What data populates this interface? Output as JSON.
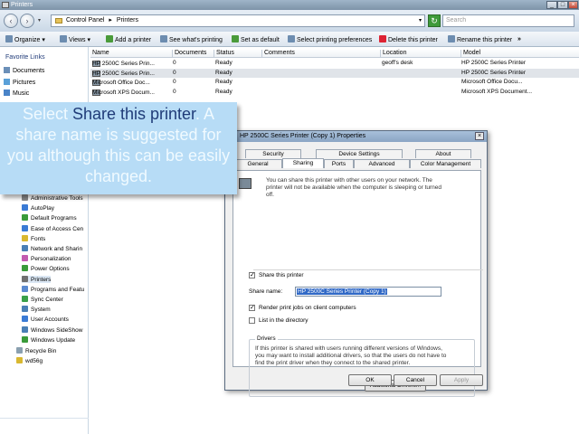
{
  "window": {
    "title": "Printers"
  },
  "address": {
    "parts": [
      "Control Panel",
      "Printers"
    ],
    "search_placeholder": "Search"
  },
  "toolbar": {
    "organize": "Organize",
    "views": "Views",
    "add_printer": "Add a printer",
    "see_printing": "See what's printing",
    "set_default": "Set as default",
    "select_prefs": "Select printing preferences",
    "delete_printer": "Delete this printer",
    "rename_printer": "Rename this printer",
    "more": "»"
  },
  "sidebar": {
    "heading": "Favorite Links",
    "favorites": [
      "Documents",
      "Pictures",
      "Music"
    ],
    "tree": [
      {
        "label": "Administrative Tools",
        "color": "#8a8a8a"
      },
      {
        "label": "AutoPlay",
        "color": "#3a7bd5"
      },
      {
        "label": "Default Programs",
        "color": "#3a9b3a"
      },
      {
        "label": "Ease of Access Cen",
        "color": "#3a7bd5"
      },
      {
        "label": "Fonts",
        "color": "#d9b830"
      },
      {
        "label": "Network and Sharin",
        "color": "#4a7fb5"
      },
      {
        "label": "Personalization",
        "color": "#c25bb0"
      },
      {
        "label": "Power Options",
        "color": "#3a9b3a"
      },
      {
        "label": "Printers",
        "color": "#707070"
      },
      {
        "label": "Programs and Featu",
        "color": "#5a8ad0"
      },
      {
        "label": "Sync Center",
        "color": "#3aa04a"
      },
      {
        "label": "System",
        "color": "#4a7fb5"
      },
      {
        "label": "User Accounts",
        "color": "#3a7bd5"
      },
      {
        "label": "Windows SideShow",
        "color": "#4a7fb5"
      },
      {
        "label": "Windows Update",
        "color": "#3a9b3a"
      },
      {
        "label": "Recycle Bin",
        "color": "#8aa0b0"
      },
      {
        "label": "wd56g",
        "color": "#d9b830"
      }
    ]
  },
  "columns": [
    "Name",
    "Documents",
    "Status",
    "Comments",
    "Location",
    "Model"
  ],
  "rows": [
    {
      "name": "HP 2500C Series Prin...",
      "docs": "0",
      "status": "Ready",
      "comments": "",
      "location": "geoff's desk",
      "model": "HP 2500C Series Printer"
    },
    {
      "name": "HP 2500C Series Prin...",
      "docs": "0",
      "status": "Ready",
      "comments": "",
      "location": "",
      "model": "HP 2500C Series Printer"
    },
    {
      "name": "Microsoft Office Doc...",
      "docs": "0",
      "status": "Ready",
      "comments": "",
      "location": "",
      "model": "Microsoft Office Docu..."
    },
    {
      "name": "Microsoft XPS Docum...",
      "docs": "0",
      "status": "Ready",
      "comments": "",
      "location": "",
      "model": "Microsoft XPS Document..."
    }
  ],
  "callout": {
    "pre": "Select ",
    "highlight": "Share this printer",
    "post": ". A share name is suggested for you although this can be easily changed."
  },
  "dialog": {
    "title": "HP 2500C Series Printer (Copy 1) Properties",
    "tabs_top": [
      "Security",
      "Device Settings",
      "About"
    ],
    "tabs_bottom": [
      "General",
      "Sharing",
      "Ports",
      "Advanced",
      "Color Management"
    ],
    "intro": "You can share this printer with other users on your network. The printer will not be available when the computer is sleeping or turned off.",
    "share_label": "Share this printer",
    "share_name_label": "Share name:",
    "share_name_value": "HP 2500C Series Printer (Copy 1)",
    "render_label": "Render print jobs on client computers",
    "list_label": "List in the directory",
    "drivers_heading": "Drivers",
    "drivers_text": "If this printer is shared with users running different versions of Windows, you may want to install additional drivers, so that the users do not have to find the print driver when they connect to the shared printer.",
    "additional_drivers": "Additional Drivers...",
    "ok": "OK",
    "cancel": "Cancel",
    "apply": "Apply"
  }
}
